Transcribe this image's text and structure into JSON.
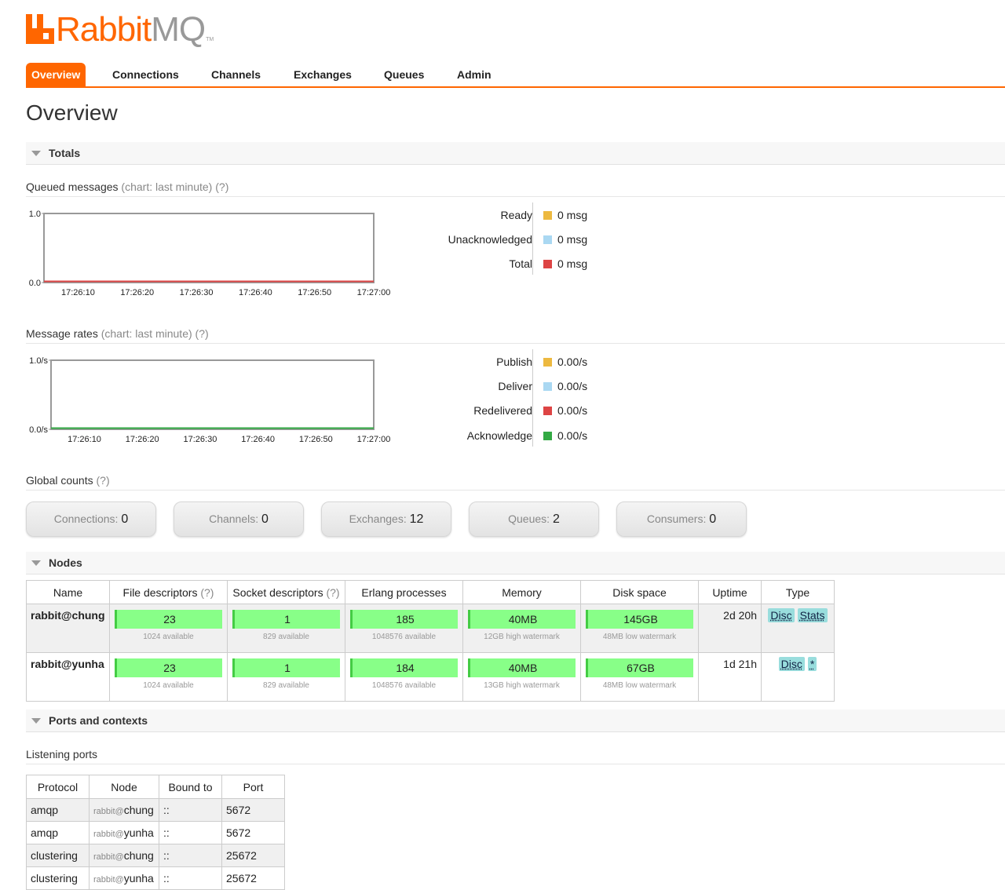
{
  "brand": {
    "name_rabbit": "Rabbit",
    "name_mq": "MQ",
    "tm": "TM"
  },
  "nav": [
    {
      "label": "Overview",
      "active": true
    },
    {
      "label": "Connections"
    },
    {
      "label": "Channels"
    },
    {
      "label": "Exchanges"
    },
    {
      "label": "Queues"
    },
    {
      "label": "Admin"
    }
  ],
  "page_title": "Overview",
  "totals": {
    "title": "Totals",
    "queued": {
      "label": "Queued messages",
      "chart_note": "(chart: last minute)",
      "help": "(?)",
      "legend": [
        {
          "name": "Ready",
          "value": "0 msg",
          "color": "#edb940"
        },
        {
          "name": "Unacknowledged",
          "value": "0 msg",
          "color": "#aad8f2"
        },
        {
          "name": "Total",
          "value": "0 msg",
          "color": "#dd4444"
        }
      ]
    },
    "rates": {
      "label": "Message rates",
      "chart_note": "(chart: last minute)",
      "help": "(?)",
      "legend": [
        {
          "name": "Publish",
          "value": "0.00/s",
          "color": "#edb940"
        },
        {
          "name": "Deliver",
          "value": "0.00/s",
          "color": "#aad8f2"
        },
        {
          "name": "Redelivered",
          "value": "0.00/s",
          "color": "#dd4444"
        },
        {
          "name": "Acknowledge",
          "value": "0.00/s",
          "color": "#33aa44"
        }
      ]
    },
    "global_counts": {
      "label": "Global counts",
      "help": "(?)",
      "items": [
        {
          "label": "Connections:",
          "value": "0"
        },
        {
          "label": "Channels:",
          "value": "0"
        },
        {
          "label": "Exchanges:",
          "value": "12"
        },
        {
          "label": "Queues:",
          "value": "2"
        },
        {
          "label": "Consumers:",
          "value": "0"
        }
      ]
    }
  },
  "chart_data": [
    {
      "type": "line",
      "x": [
        "17:26:10",
        "17:26:20",
        "17:26:30",
        "17:26:40",
        "17:26:50",
        "17:27:00"
      ],
      "yticks": [
        "1.0",
        "0.0"
      ],
      "ylim": [
        0,
        1
      ],
      "series": [
        {
          "name": "Ready",
          "values": [
            0,
            0,
            0,
            0,
            0,
            0
          ]
        },
        {
          "name": "Unacknowledged",
          "values": [
            0,
            0,
            0,
            0,
            0,
            0
          ]
        },
        {
          "name": "Total",
          "values": [
            0,
            0,
            0,
            0,
            0,
            0
          ]
        }
      ]
    },
    {
      "type": "line",
      "x": [
        "17:26:10",
        "17:26:20",
        "17:26:30",
        "17:26:40",
        "17:26:50",
        "17:27:00"
      ],
      "yticks": [
        "1.0/s",
        "0.0/s"
      ],
      "ylim": [
        0,
        1
      ],
      "series": [
        {
          "name": "Publish",
          "values": [
            0,
            0,
            0,
            0,
            0,
            0
          ]
        },
        {
          "name": "Deliver",
          "values": [
            0,
            0,
            0,
            0,
            0,
            0
          ]
        },
        {
          "name": "Redelivered",
          "values": [
            0,
            0,
            0,
            0,
            0,
            0
          ]
        },
        {
          "name": "Acknowledge",
          "values": [
            0,
            0,
            0,
            0,
            0,
            0
          ]
        }
      ]
    }
  ],
  "nodes": {
    "title": "Nodes",
    "headers": {
      "name": "Name",
      "fd": "File descriptors",
      "sd": "Socket descriptors",
      "erl": "Erlang processes",
      "mem": "Memory",
      "disk": "Disk space",
      "uptime": "Uptime",
      "type": "Type",
      "help": "(?)"
    },
    "rows": [
      {
        "name": "rabbit@chung",
        "fd": "23",
        "fd_sub": "1024 available",
        "sd": "1",
        "sd_sub": "829 available",
        "erl": "185",
        "erl_sub": "1048576 available",
        "mem": "40MB",
        "mem_sub": "12GB high watermark",
        "disk": "145GB",
        "disk_sub": "48MB low watermark",
        "uptime": "2d 20h",
        "tags": [
          "Disc",
          "Stats"
        ]
      },
      {
        "name": "rabbit@yunha",
        "fd": "23",
        "fd_sub": "1024 available",
        "sd": "1",
        "sd_sub": "829 available",
        "erl": "184",
        "erl_sub": "1048576 available",
        "mem": "40MB",
        "mem_sub": "13GB high watermark",
        "disk": "67GB",
        "disk_sub": "48MB low watermark",
        "uptime": "1d 21h",
        "tags": [
          "Disc",
          "*"
        ]
      }
    ]
  },
  "ports": {
    "title": "Ports and contexts",
    "listening_label": "Listening ports",
    "headers": {
      "protocol": "Protocol",
      "node": "Node",
      "bound": "Bound to",
      "port": "Port"
    },
    "rows": [
      {
        "protocol": "amqp",
        "node_prefix": "rabbit@",
        "node_host": "chung",
        "bound": "::",
        "port": "5672"
      },
      {
        "protocol": "amqp",
        "node_prefix": "rabbit@",
        "node_host": "yunha",
        "bound": "::",
        "port": "5672"
      },
      {
        "protocol": "clustering",
        "node_prefix": "rabbit@",
        "node_host": "chung",
        "bound": "::",
        "port": "25672"
      },
      {
        "protocol": "clustering",
        "node_prefix": "rabbit@",
        "node_host": "yunha",
        "bound": "::",
        "port": "25672"
      }
    ]
  }
}
